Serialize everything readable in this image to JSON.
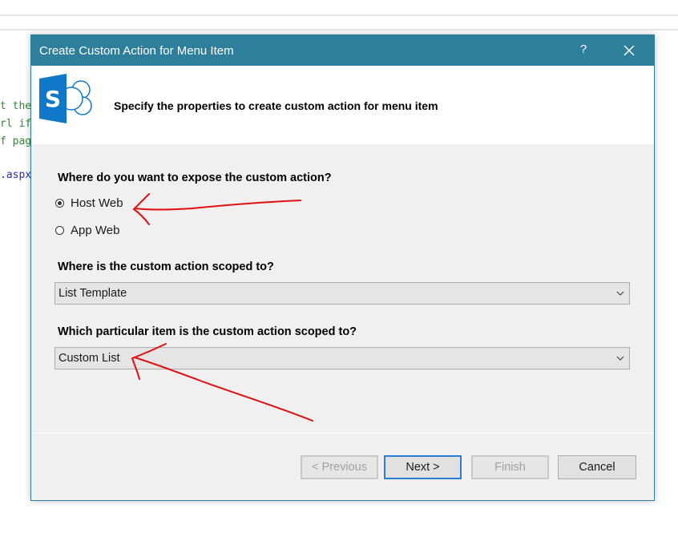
{
  "background": {
    "code_lines": [
      {
        "text": "t the",
        "color": "green"
      },
      {
        "text": "rl if",
        "color": "green"
      },
      {
        "text": "f pag",
        "color": "green"
      },
      {
        "text": ".aspx",
        "color": "blue"
      }
    ]
  },
  "dialog": {
    "title": "Create Custom Action for Menu Item",
    "help_label": "?",
    "close_icon": "close-icon",
    "logo_icon": "sharepoint-logo",
    "subtitle": "Specify the properties to create custom action for menu item",
    "expose_question": "Where do you want to expose the custom action?",
    "expose_options": [
      {
        "label": "Host Web",
        "selected": true
      },
      {
        "label": "App Web",
        "selected": false
      }
    ],
    "scope_question": "Where is the custom action scoped to?",
    "scope_value": "List Template",
    "item_question": "Which particular item is the custom action scoped to?",
    "item_value": "Custom List",
    "buttons": {
      "previous": "< Previous",
      "next": "Next >",
      "finish": "Finish",
      "cancel": "Cancel"
    }
  },
  "colors": {
    "titlebar": "#2e7f9c",
    "logo_blue": "#0f78c8",
    "annotation_red": "#e01010",
    "primary_border": "#2a7fd4"
  }
}
